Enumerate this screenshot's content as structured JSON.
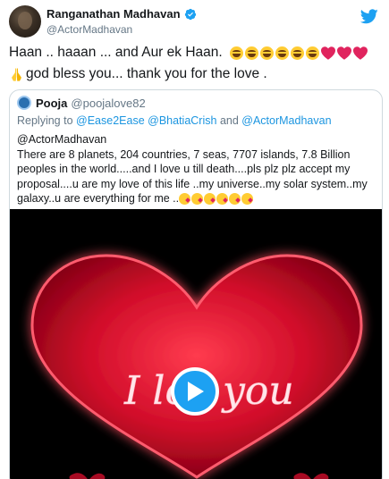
{
  "author": {
    "name": "Ranganathan Madhavan",
    "handle": "@ActorMadhavan",
    "verified_icon": "verified-badge-icon",
    "platform_icon": "twitter-bird-icon"
  },
  "tweet": {
    "line1_text": "Haan .. haaan ... and Aur ek Haan.",
    "line2_text": "god bless you... thank you for the love ."
  },
  "quoted": {
    "name": "Pooja",
    "handle": "@poojalove82",
    "reply_prefix": "Replying to",
    "reply_to_1": "@Ease2Ease",
    "reply_to_2": "@BhatiaCrish",
    "reply_and": "and",
    "reply_to_3": "@ActorMadhavan",
    "mention": "@ActorMadhavan",
    "body": "There are 8 planets, 204 countries, 7 seas, 7707 islands, 7.8 Billion peoples in the world.....and I love u till death....pls plz plz accept my proposal....u are my love of this life ..my universe..my solar system..my galaxy..u are everything for me ..",
    "media_text_left": "I lo",
    "media_text_right": "you"
  },
  "colors": {
    "link": "#1b95e0",
    "muted": "#657786",
    "play": "#1da1f2",
    "heart": "#e0245e",
    "media_heart": "#d10d2a"
  }
}
